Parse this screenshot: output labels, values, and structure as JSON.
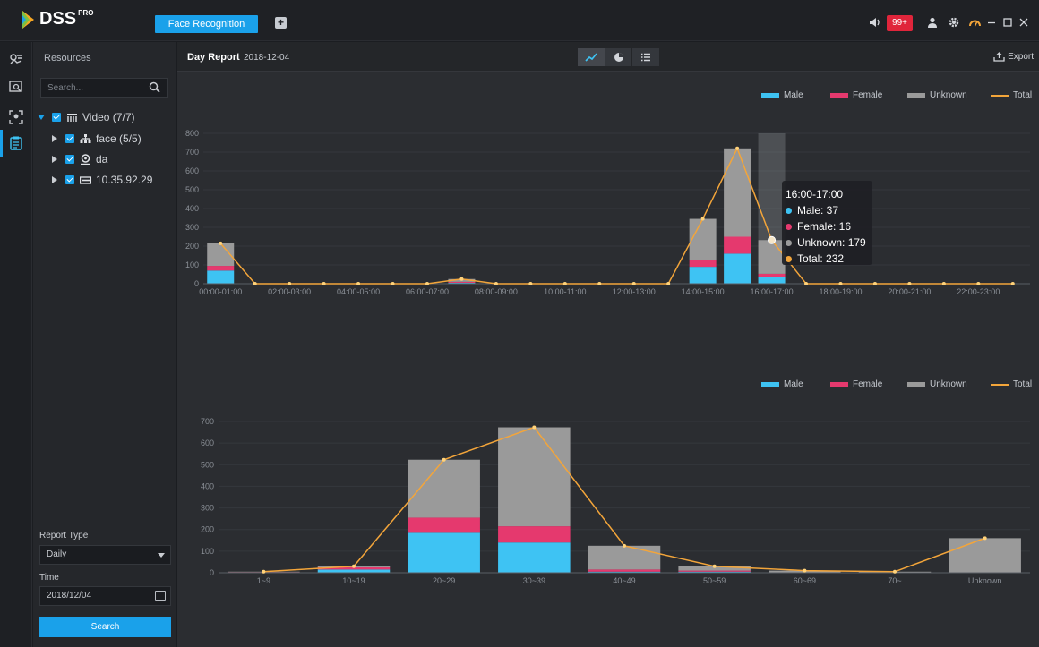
{
  "app": {
    "logo_text": "DSS",
    "logo_sup": "PRO",
    "active_tab": "Face Recognition",
    "alert_count": "99+"
  },
  "colors": {
    "accent": "#1aa1ea",
    "male": "#3ec3f3",
    "female": "#e5396e",
    "unknown": "#9a9a9a",
    "total": "#f3a53a",
    "alert": "#e0253b"
  },
  "icons": {
    "rail": [
      "monitor-icon",
      "face-search-icon",
      "face-capture-icon",
      "report-icon"
    ],
    "topbar": [
      "speaker-icon",
      "user-icon",
      "gear-icon",
      "gauge-icon",
      "minimize-icon",
      "maximize-icon",
      "close-icon"
    ]
  },
  "resources": {
    "title": "Resources",
    "search_placeholder": "Search...",
    "tree": [
      {
        "label": "Video (7/7)",
        "level": 0,
        "expanded": true,
        "icon": "device-tree-icon"
      },
      {
        "label": "face (5/5)",
        "level": 1,
        "expanded": false,
        "icon": "org-icon"
      },
      {
        "label": "da",
        "level": 1,
        "expanded": false,
        "icon": "camera-icon"
      },
      {
        "label": "10.35.92.29",
        "level": 1,
        "expanded": false,
        "icon": "nvr-icon"
      }
    ],
    "report_type_label": "Report Type",
    "report_type_value": "Daily",
    "time_label": "Time",
    "time_value": "2018/12/04",
    "search_button": "Search"
  },
  "report": {
    "title": "Day Report",
    "date": "2018-12-04",
    "export_label": "Export",
    "views": [
      "line-chart-icon",
      "pie-chart-icon",
      "list-icon"
    ]
  },
  "legend": {
    "male": "Male",
    "female": "Female",
    "unknown": "Unknown",
    "total": "Total"
  },
  "tooltip": {
    "title": "16:00-17:00",
    "rows": [
      "Male: 37",
      "Female: 16",
      "Unknown: 179",
      "Total: 232"
    ]
  },
  "chart_data": [
    {
      "type": "bar",
      "stacked": true,
      "categories": [
        "00:00-01:00",
        "01:00-02:00",
        "02:00-03:00",
        "03:00-04:00",
        "04:00-05:00",
        "05:00-06:00",
        "06:00-07:00",
        "07:00-08:00",
        "08:00-09:00",
        "09:00-10:00",
        "10:00-11:00",
        "11:00-12:00",
        "12:00-13:00",
        "13:00-14:00",
        "14:00-15:00",
        "15:00-16:00",
        "16:00-17:00",
        "17:00-18:00",
        "18:00-19:00",
        "19:00-20:00",
        "20:00-21:00",
        "21:00-22:00",
        "22:00-23:00",
        "23:00-24:00"
      ],
      "tick_labels": [
        "00:00-01:00",
        "02:00-03:00",
        "04:00-05:00",
        "06:00-07:00",
        "08:00-09:00",
        "10:00-11:00",
        "12:00-13:00",
        "14:00-15:00",
        "16:00-17:00",
        "18:00-19:00",
        "20:00-21:00",
        "22:00-23:00"
      ],
      "series": [
        {
          "name": "Male",
          "values": [
            70,
            0,
            0,
            0,
            0,
            0,
            0,
            5,
            0,
            0,
            0,
            0,
            0,
            0,
            90,
            160,
            37,
            0,
            0,
            0,
            0,
            0,
            0,
            0
          ]
        },
        {
          "name": "Female",
          "values": [
            25,
            0,
            0,
            0,
            0,
            0,
            0,
            5,
            0,
            0,
            0,
            0,
            0,
            0,
            35,
            90,
            16,
            0,
            0,
            0,
            0,
            0,
            0,
            0
          ]
        },
        {
          "name": "Unknown",
          "values": [
            120,
            0,
            0,
            0,
            0,
            0,
            0,
            15,
            0,
            0,
            0,
            0,
            0,
            0,
            220,
            470,
            179,
            0,
            0,
            0,
            0,
            0,
            0,
            0
          ]
        },
        {
          "name": "Total",
          "type": "line",
          "values": [
            215,
            0,
            0,
            0,
            0,
            0,
            0,
            25,
            0,
            0,
            0,
            0,
            0,
            0,
            345,
            720,
            232,
            0,
            0,
            0,
            0,
            0,
            0,
            0
          ]
        }
      ],
      "highlight_category": "16:00-17:00",
      "ylim": [
        0,
        800
      ],
      "yticks": [
        0,
        100,
        200,
        300,
        400,
        500,
        600,
        700,
        800
      ],
      "grid": true,
      "legend_position": "top-right"
    },
    {
      "type": "bar",
      "stacked": true,
      "categories": [
        "1~9",
        "10~19",
        "20~29",
        "30~39",
        "40~49",
        "50~59",
        "60~69",
        "70~",
        "Unknown"
      ],
      "series": [
        {
          "name": "Male",
          "values": [
            2,
            15,
            185,
            140,
            5,
            5,
            0,
            0,
            0
          ]
        },
        {
          "name": "Female",
          "values": [
            1,
            10,
            70,
            75,
            10,
            5,
            0,
            0,
            0
          ]
        },
        {
          "name": "Unknown",
          "values": [
            2,
            5,
            268,
            458,
            110,
            20,
            10,
            5,
            160
          ]
        },
        {
          "name": "Total",
          "type": "line",
          "values": [
            5,
            30,
            523,
            673,
            125,
            30,
            10,
            5,
            160
          ]
        }
      ],
      "ylim": [
        0,
        700
      ],
      "yticks": [
        0,
        100,
        200,
        300,
        400,
        500,
        600,
        700
      ],
      "grid": true,
      "legend_position": "top-right"
    }
  ]
}
